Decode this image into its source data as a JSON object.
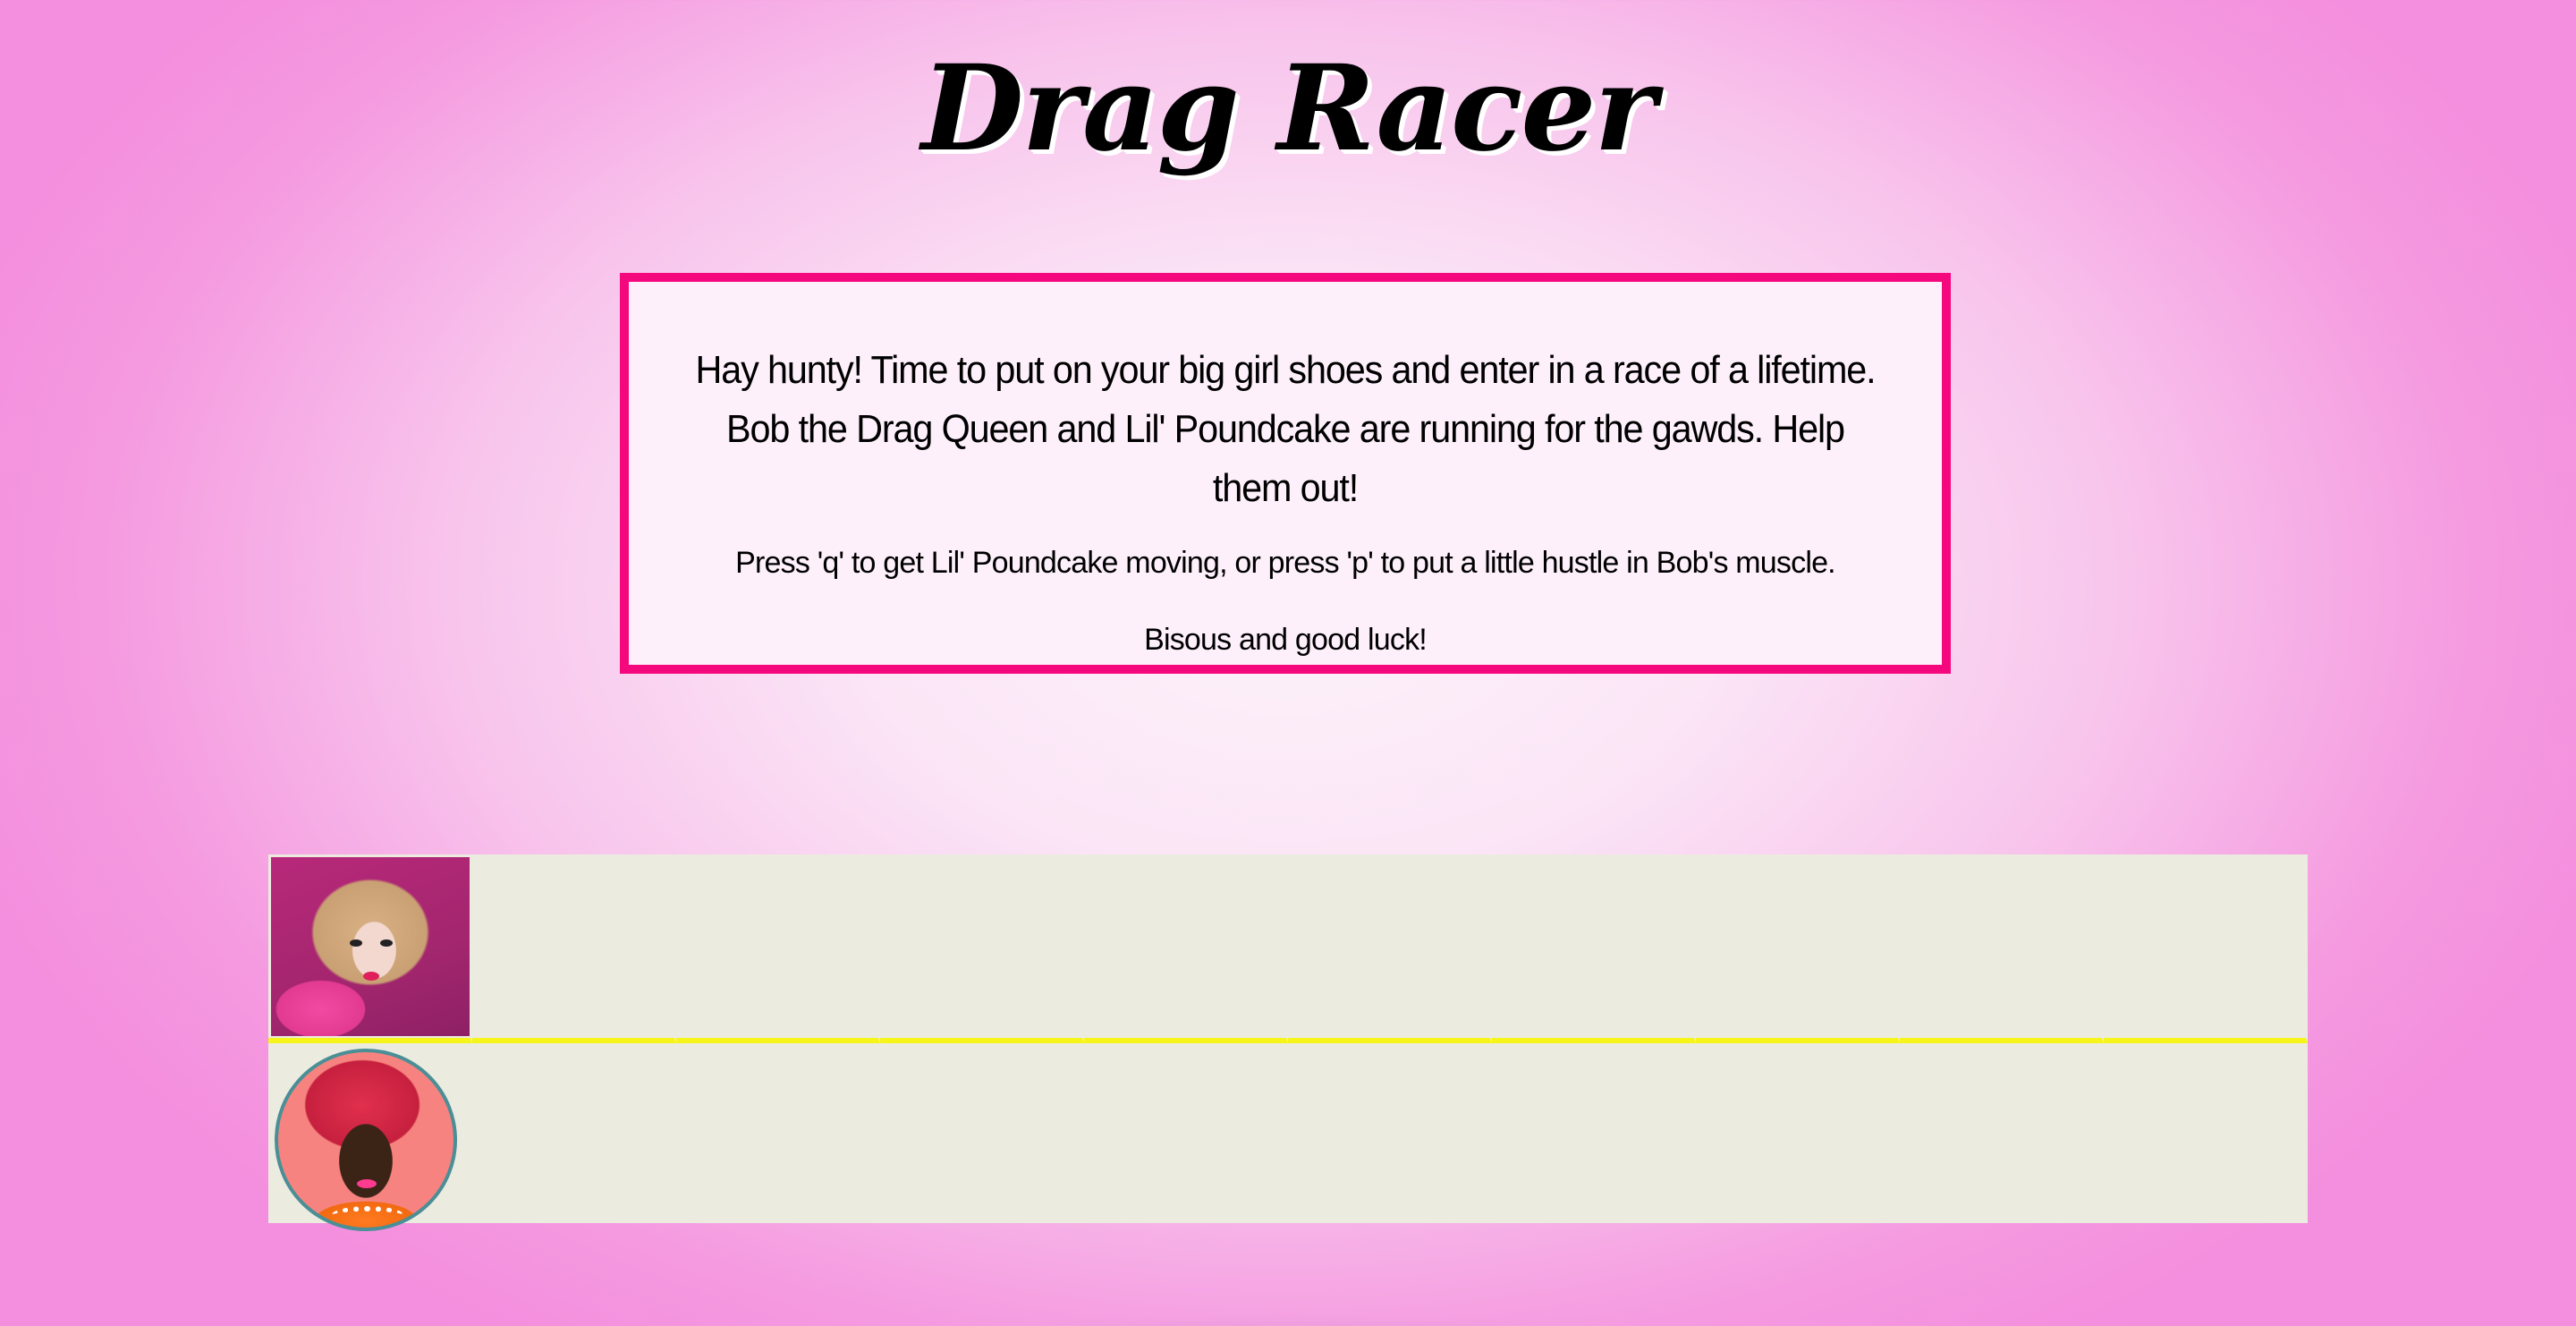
{
  "page": {
    "title": "Drag Racer",
    "colors": {
      "background_center": "#fdf3fb",
      "background_edge": "#f48ede",
      "box_border": "#f5087e",
      "track": "#ecebe0",
      "lane_divider": "#f6f51a"
    }
  },
  "intro": {
    "main": "Hay hunty! Time to put on your big girl shoes and enter in a race of a lifetime. Bob the Drag Queen and Lil' Poundcake are running for the gawds. Help them out!",
    "instructions": "Press 'q' to get Lil' Poundcake moving, or press 'p' to put a little hustle in Bob's muscle.",
    "sign_off": "Bisous and good luck!"
  },
  "track": {
    "cells_per_lane": 10,
    "lanes": [
      {
        "racer": "Lil' Poundcake",
        "key": "q",
        "position": 1
      },
      {
        "racer": "Bob the Drag Queen",
        "key": "p",
        "position": 1
      }
    ]
  }
}
